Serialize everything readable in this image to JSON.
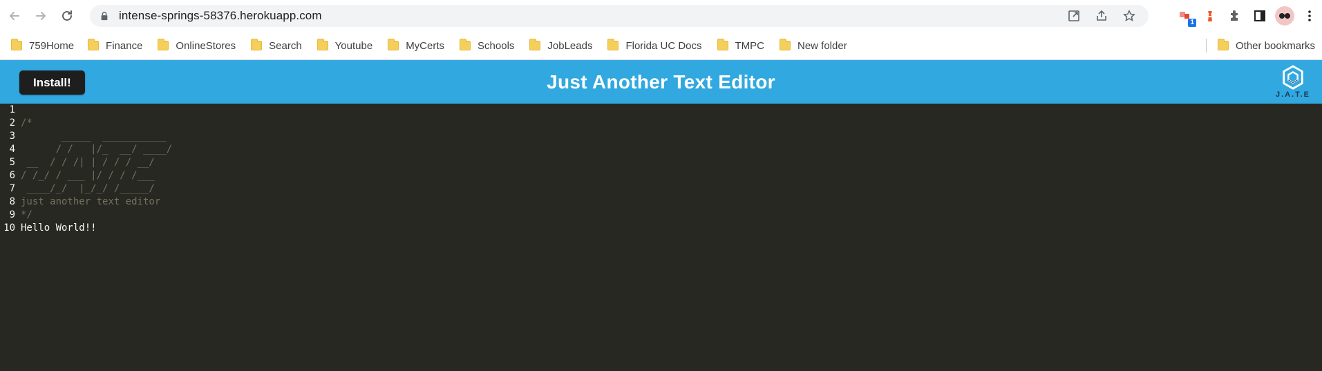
{
  "browser": {
    "url": "intense-springs-58376.herokuapp.com",
    "extension_badge": "1",
    "bookmarks": [
      "759Home",
      "Finance",
      "OnlineStores",
      "Search",
      "Youtube",
      "MyCerts",
      "Schools",
      "JobLeads",
      "Florida UC Docs",
      "TMPC",
      "New folder"
    ],
    "other_bookmarks": "Other bookmarks"
  },
  "app": {
    "install_label": "Install!",
    "title": "Just Another Text Editor",
    "logo_text": "J.A.T.E"
  },
  "editor": {
    "lines": [
      {
        "num": "1",
        "text": "",
        "kind": "comment"
      },
      {
        "num": "2",
        "text": "/*",
        "kind": "comment"
      },
      {
        "num": "3",
        "text": "       _____  ___________",
        "kind": "comment"
      },
      {
        "num": "4",
        "text": "      / /   |/_  __/ ____/",
        "kind": "comment"
      },
      {
        "num": "5",
        "text": " __  / / /| | / / / __/",
        "kind": "comment"
      },
      {
        "num": "6",
        "text": "/ /_/ / ___ |/ / / /___",
        "kind": "comment"
      },
      {
        "num": "7",
        "text": " ____/_/  |_/_/ /_____/",
        "kind": "comment"
      },
      {
        "num": "8",
        "text": "just another text editor",
        "kind": "comment"
      },
      {
        "num": "9",
        "text": "*/",
        "kind": "comment"
      },
      {
        "num": "10",
        "text": "Hello World!!",
        "kind": "plain"
      }
    ]
  },
  "colors": {
    "header_bg": "#31a8e0",
    "editor_bg": "#272822",
    "comment": "#75715e",
    "text": "#f8f8f2"
  }
}
